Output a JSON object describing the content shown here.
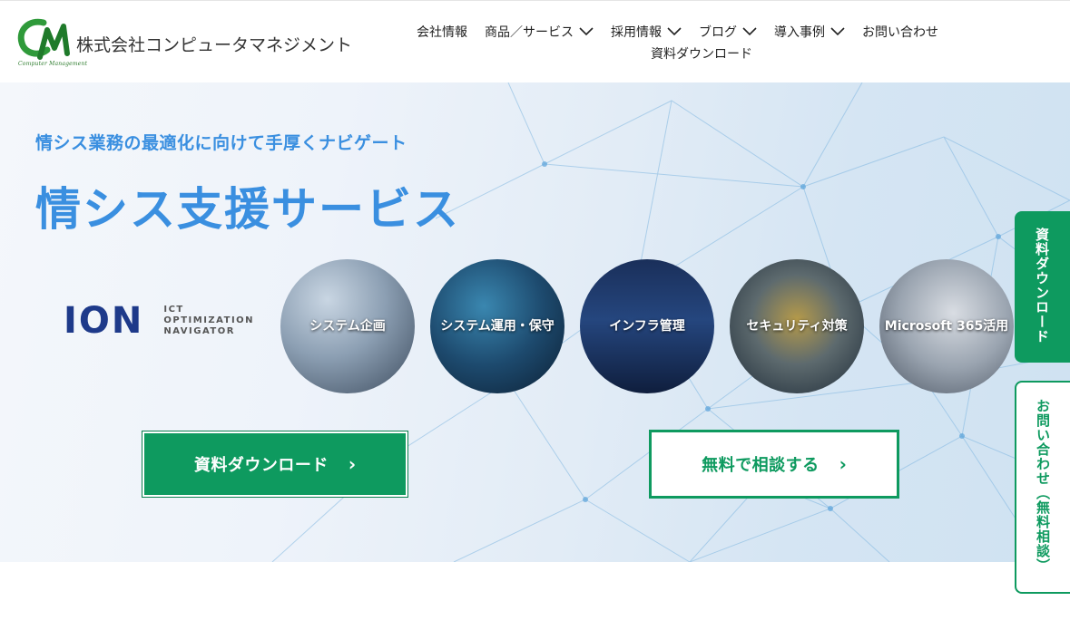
{
  "brand": {
    "company_name": "株式会社コンピュータマネジメント",
    "logo_sub": "Computer Management",
    "green": "#0e9a5f",
    "blue": "#3a8fe0"
  },
  "nav": {
    "items": [
      {
        "label": "会社情報",
        "dropdown": false
      },
      {
        "label": "商品／サービス",
        "dropdown": true
      },
      {
        "label": "採用情報",
        "dropdown": true
      },
      {
        "label": "ブログ",
        "dropdown": true
      },
      {
        "label": "導入事例",
        "dropdown": true
      },
      {
        "label": "お問い合わせ",
        "dropdown": false
      }
    ],
    "second_row": "資料ダウンロード"
  },
  "hero": {
    "tagline": "情シス業務の最適化に向けて手厚くナビゲート",
    "title": "情シス支援サービス",
    "ion_logo": "ION",
    "ion_sub": [
      "ICT",
      "OPTIMIZATION",
      "NAVIGATOR"
    ],
    "services": [
      {
        "label": "システム企画"
      },
      {
        "label": "システム運用・保守"
      },
      {
        "label": "インフラ管理"
      },
      {
        "label": "セキュリティ対策"
      },
      {
        "label": "Microsoft 365活用"
      }
    ],
    "download_button": "資料ダウンロード",
    "consult_button": "無料で相談する"
  },
  "side_tabs": {
    "download": "資料ダウンロード",
    "contact": "お問い合わせ（無料相談）"
  }
}
